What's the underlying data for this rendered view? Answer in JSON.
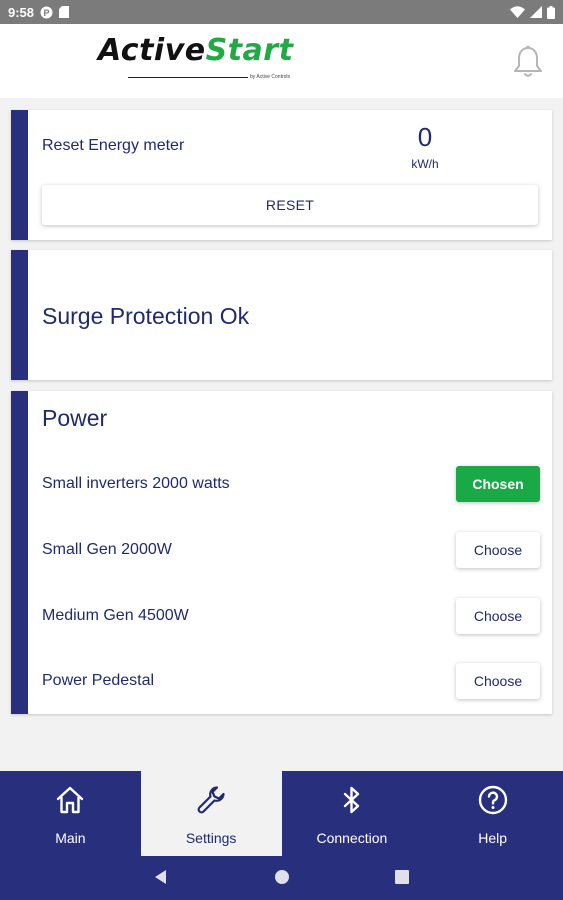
{
  "status_bar": {
    "time": "9:58",
    "left_icons": [
      "notification-p-icon",
      "sd-card-icon"
    ],
    "right_icons": [
      "wifi-icon",
      "signal-icon",
      "battery-icon"
    ]
  },
  "header": {
    "logo_part1": "Active",
    "logo_part2": "Start",
    "logo_tagline": "by Active Controls",
    "bell_icon": "bell-icon"
  },
  "reset_card": {
    "label": "Reset Energy meter",
    "value": "0",
    "unit": "kW/h",
    "button_label": "RESET"
  },
  "surge_card": {
    "text": "Surge Protection Ok"
  },
  "power_card": {
    "title": "Power",
    "options": [
      {
        "label": "Small inverters 2000 watts",
        "button": "Chosen",
        "selected": true
      },
      {
        "label": "Small Gen 2000W",
        "button": "Choose",
        "selected": false
      },
      {
        "label": "Medium Gen 4500W",
        "button": "Choose",
        "selected": false
      },
      {
        "label": "Power Pedestal",
        "button": "Choose",
        "selected": false
      }
    ]
  },
  "bottom_nav": {
    "items": [
      {
        "label": "Main",
        "icon": "home-icon",
        "active": false
      },
      {
        "label": "Settings",
        "icon": "wrench-icon",
        "active": true
      },
      {
        "label": "Connection",
        "icon": "bluetooth-icon",
        "active": false
      },
      {
        "label": "Help",
        "icon": "help-circle-icon",
        "active": false
      }
    ]
  },
  "colors": {
    "primary": "#282f7d",
    "text": "#1f2a6f",
    "accent_green": "#1aa947",
    "background": "#f2f2f2"
  }
}
